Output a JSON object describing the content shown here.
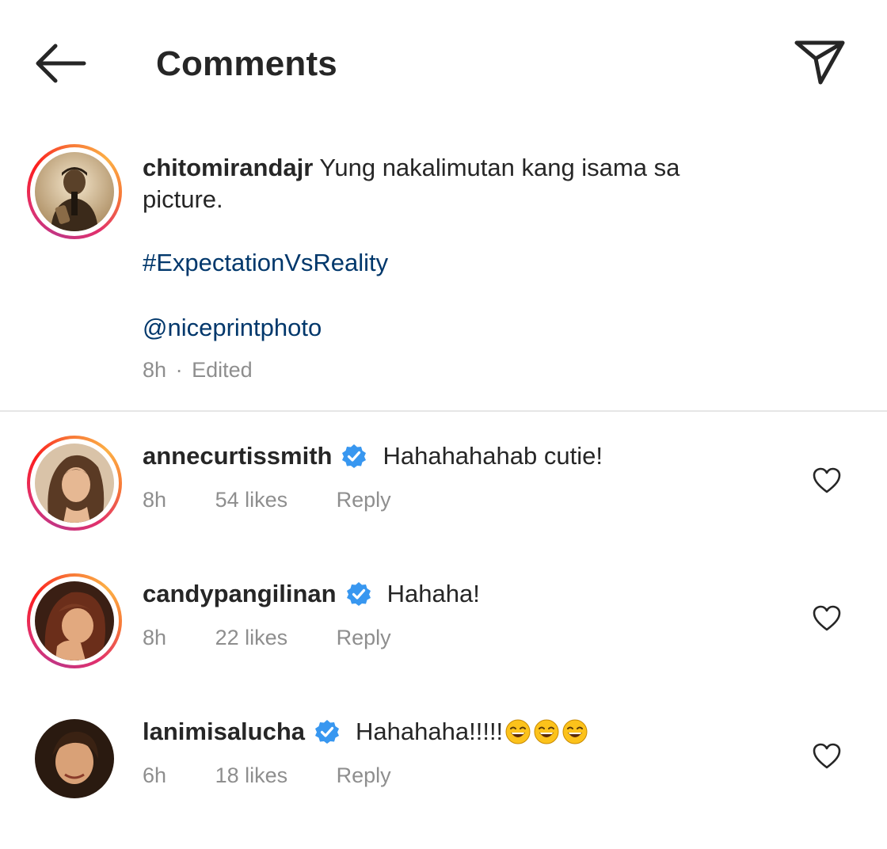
{
  "header": {
    "title": "Comments",
    "back_icon": "arrow-left-icon",
    "share_icon": "paper-plane-icon"
  },
  "caption": {
    "username": "chitomirandajr",
    "text": "Yung nakalimutan kang isama sa picture.",
    "hashtag": "#ExpectationVsReality",
    "mention": "@niceprintphoto",
    "time": "8h",
    "separator": "·",
    "edited": "Edited"
  },
  "comments": [
    {
      "username": "annecurtissmith",
      "verified": true,
      "text": "Hahahahahab cutie!",
      "time": "8h",
      "likes": "54 likes",
      "reply": "Reply"
    },
    {
      "username": "candypangilinan",
      "verified": true,
      "text": "Hahaha!",
      "time": "8h",
      "likes": "22 likes",
      "reply": "Reply"
    },
    {
      "username": "lanimisalucha",
      "verified": true,
      "text": "Hahahaha!!!!!",
      "emoji": "😂😂😂",
      "time": "6h",
      "likes": "18 likes",
      "reply": "Reply"
    }
  ],
  "colors": {
    "link": "#00376b",
    "muted": "#8e8e8e",
    "verified": "#3897f0",
    "text": "#262626"
  }
}
